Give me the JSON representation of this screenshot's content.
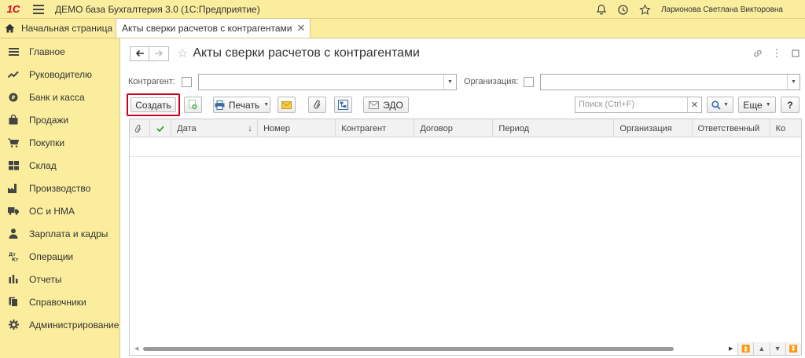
{
  "app": {
    "logo_text": "1С",
    "title": "ДЕМО база Бухгалтерия 3.0  (1С:Предприятие)",
    "user": "Ларионова Светлана Викторовна"
  },
  "tabs": {
    "home": "Начальная страница",
    "active": "Акты сверки расчетов с контрагентами"
  },
  "sidebar": {
    "items": [
      {
        "label": "Главное",
        "icon": "list-icon"
      },
      {
        "label": "Руководителю",
        "icon": "trend-icon"
      },
      {
        "label": "Банк и касса",
        "icon": "coin-icon"
      },
      {
        "label": "Продажи",
        "icon": "bag-icon"
      },
      {
        "label": "Покупки",
        "icon": "cart-icon"
      },
      {
        "label": "Склад",
        "icon": "warehouse-icon"
      },
      {
        "label": "Производство",
        "icon": "factory-icon"
      },
      {
        "label": "ОС и НМА",
        "icon": "truck-icon"
      },
      {
        "label": "Зарплата и кадры",
        "icon": "person-icon"
      },
      {
        "label": "Операции",
        "icon": "operations-icon"
      },
      {
        "label": "Отчеты",
        "icon": "bar-chart-icon"
      },
      {
        "label": "Справочники",
        "icon": "books-icon"
      },
      {
        "label": "Администрирование",
        "icon": "gear-icon"
      }
    ]
  },
  "form": {
    "title": "Акты сверки расчетов с контрагентами",
    "filter": {
      "counterparty_label": "Контрагент:",
      "organization_label": "Организация:"
    },
    "toolbar": {
      "create": "Создать",
      "print": "Печать",
      "edo": "ЭДО",
      "search_placeholder": "Поиск (Ctrl+F)",
      "more": "Еще",
      "help": "?"
    },
    "columns": [
      "Дата",
      "Номер",
      "Контрагент",
      "Договор",
      "Период",
      "Организация",
      "Ответственный",
      "Ко"
    ]
  },
  "colors": {
    "panel": "#fbed9e",
    "highlight_border": "#c8001c"
  }
}
